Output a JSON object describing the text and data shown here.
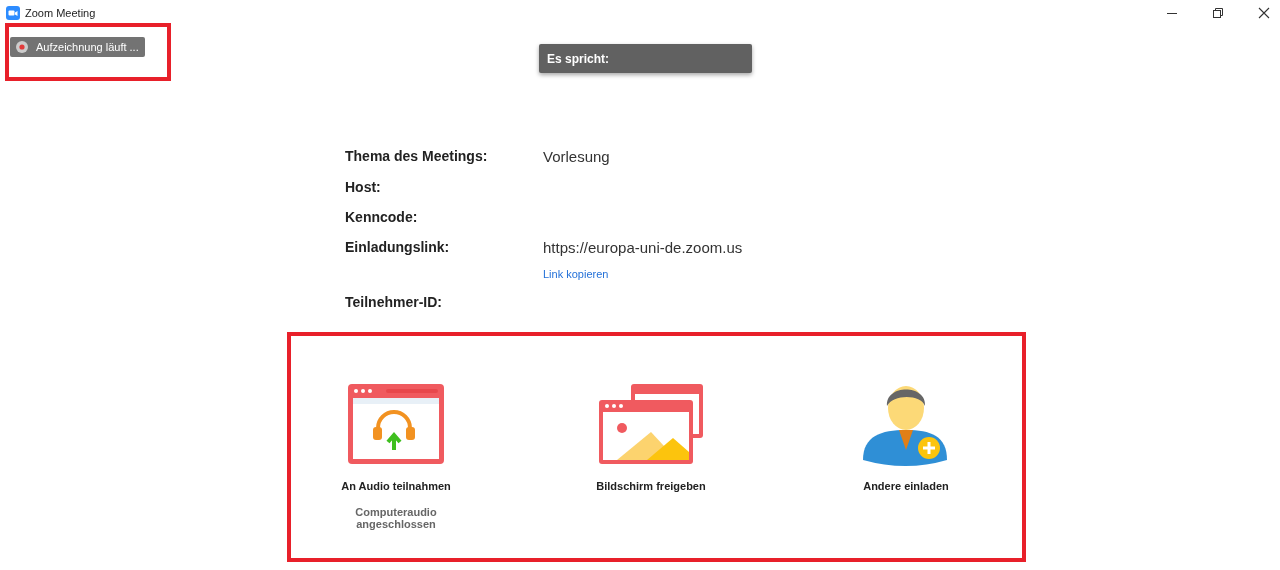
{
  "window": {
    "title": "Zoom Meeting"
  },
  "recording": {
    "label": "Aufzeichnung läuft ..."
  },
  "speaker": {
    "label": "Es spricht:"
  },
  "info": [
    {
      "label": "Thema des Meetings:",
      "value": "Vorlesung"
    },
    {
      "label": "Host:"
    },
    {
      "label": "Kenncode:"
    },
    {
      "label": "Einladungslink:",
      "value": "https://europa-uni-de.zoom.us",
      "link": "Link kopieren"
    },
    {
      "label": "Teilnehmer-ID:"
    }
  ],
  "actions": [
    {
      "kind": "audio",
      "label": "An Audio teilnahmen",
      "status": "Computeraudio angeschlossen"
    },
    {
      "kind": "share",
      "label": "Bildschirm freigeben"
    },
    {
      "kind": "invite",
      "label": "Andere einladen"
    }
  ]
}
